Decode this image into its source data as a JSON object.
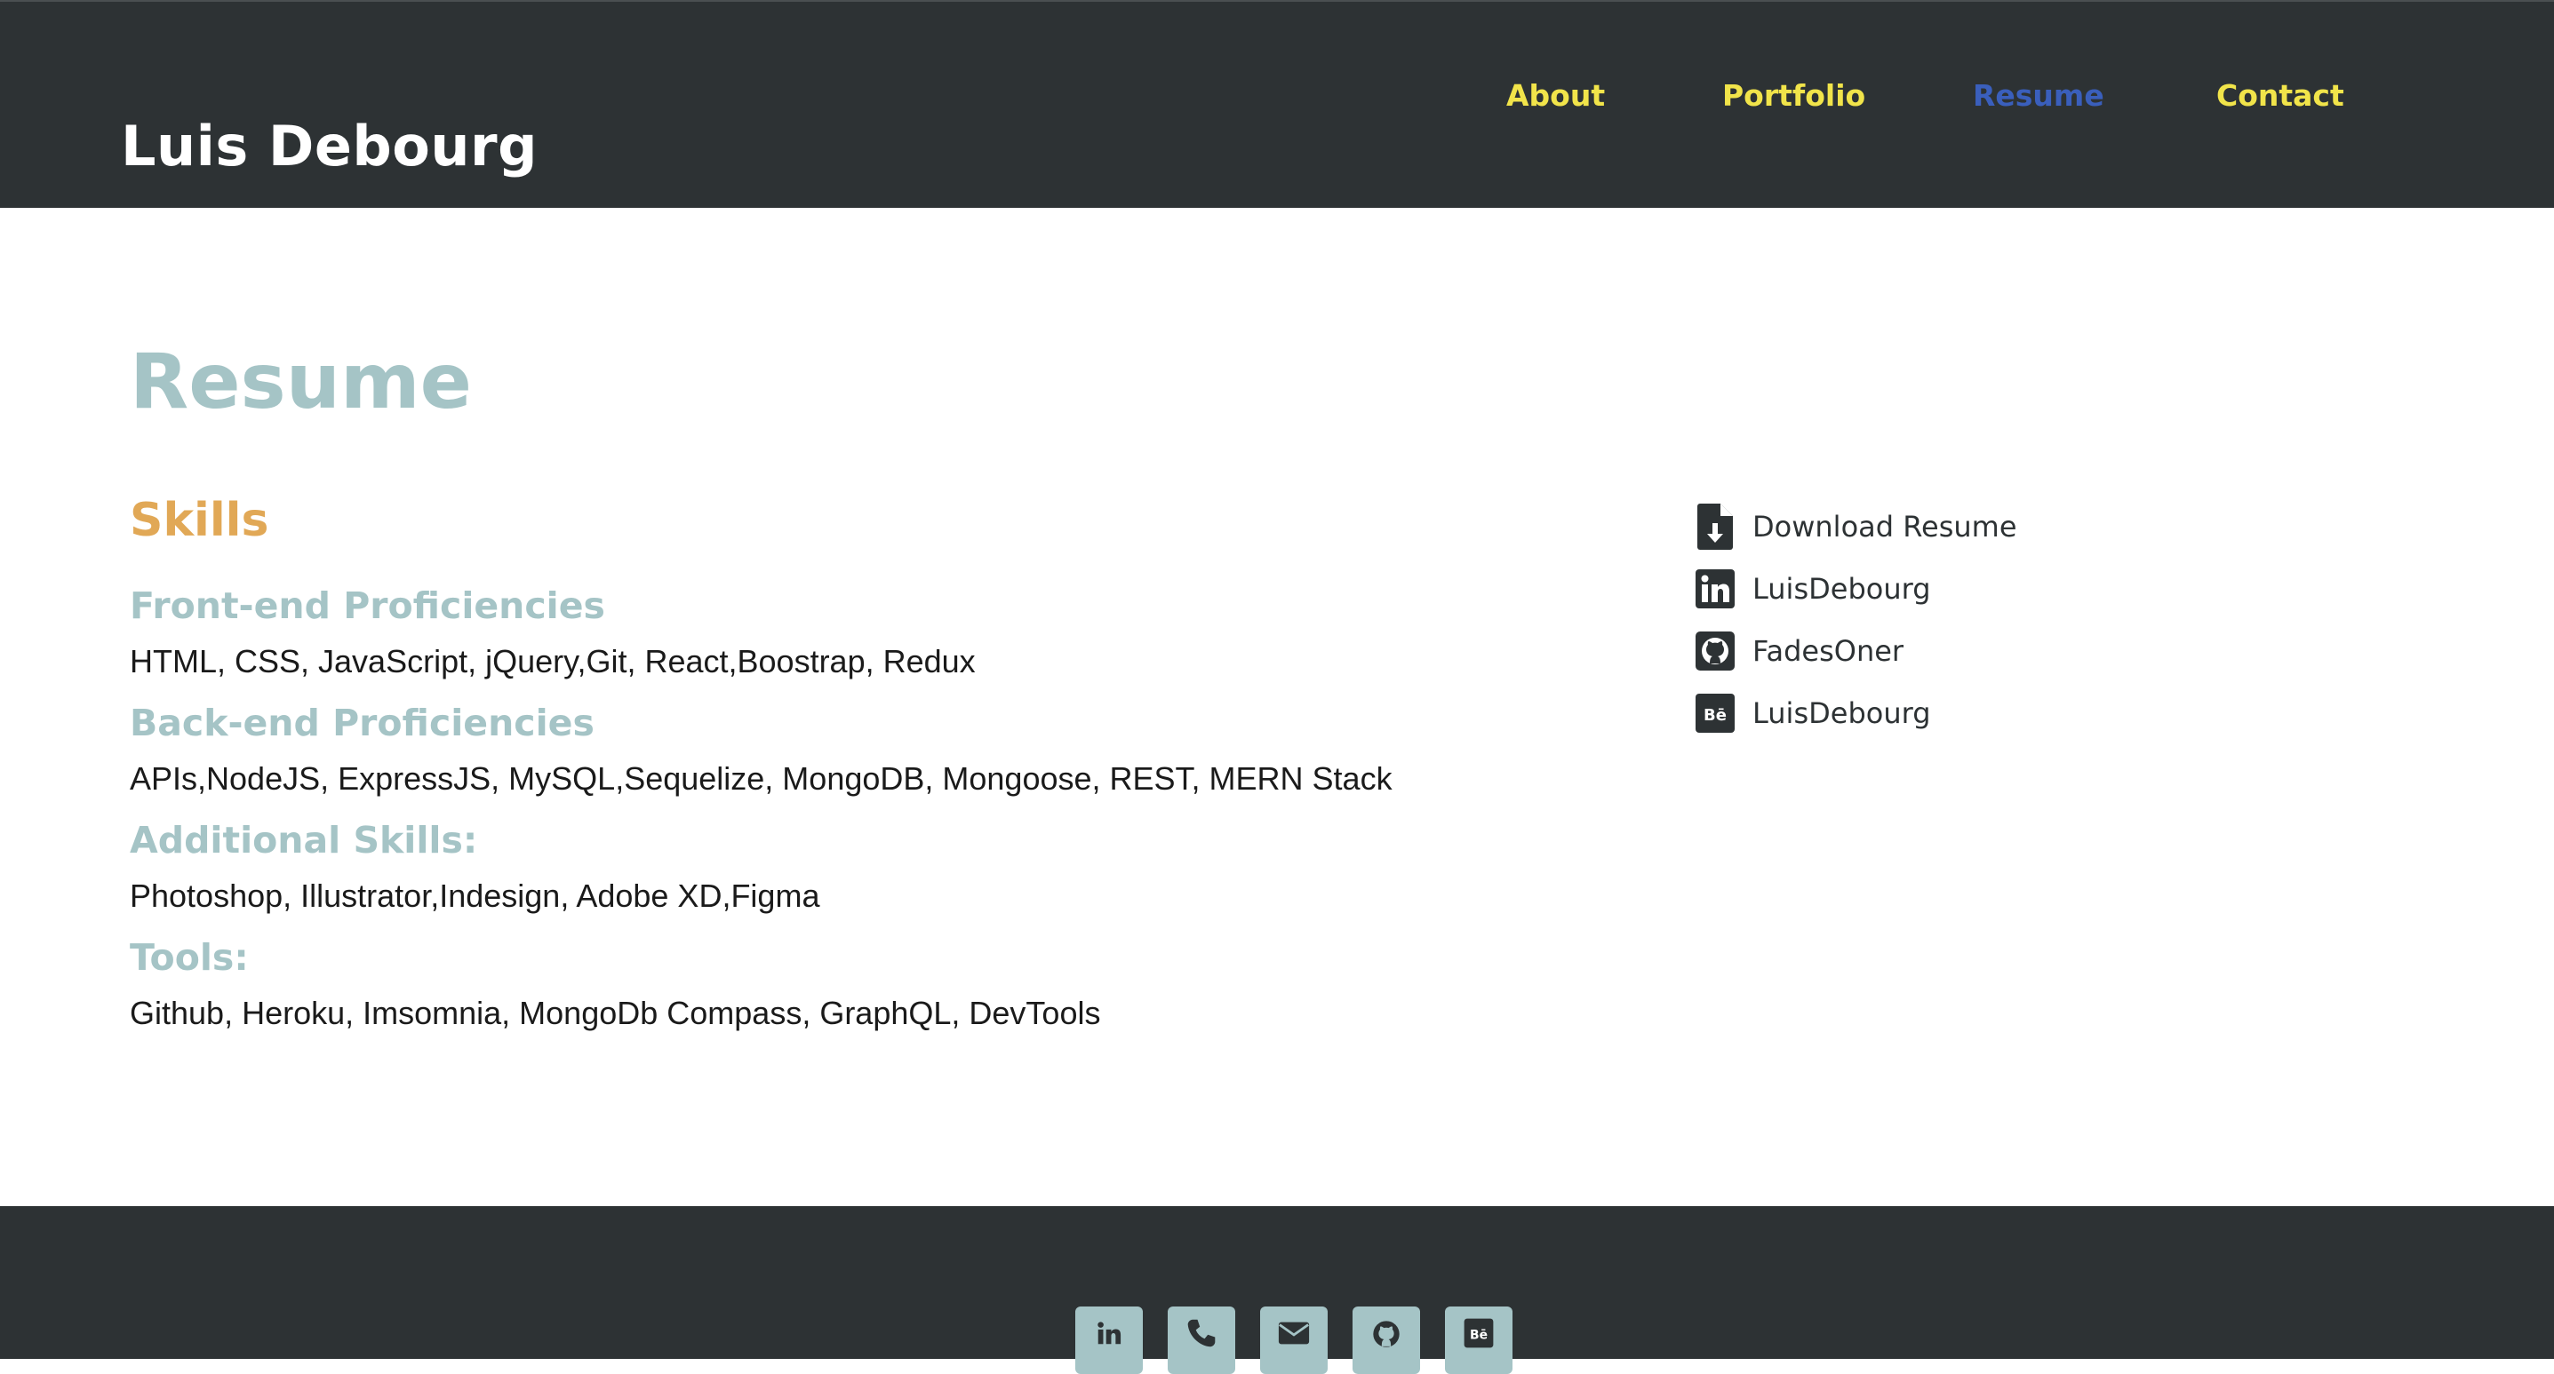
{
  "header": {
    "brand": "Luis Debourg",
    "nav": [
      {
        "label": "About",
        "active": false
      },
      {
        "label": "Portfolio",
        "active": false
      },
      {
        "label": "Resume",
        "active": true
      },
      {
        "label": "Contact",
        "active": false
      }
    ]
  },
  "main": {
    "title": "Resume",
    "section_title": "Skills",
    "skills": [
      {
        "heading": "Front-end Proficiencies",
        "text": "HTML, CSS, JavaScript, jQuery,Git, React,Boostrap, Redux"
      },
      {
        "heading": "Back-end Proficiencies",
        "text": "APIs,NodeJS, ExpressJS, MySQL,Sequelize, MongoDB, Mongoose, REST, MERN Stack"
      },
      {
        "heading": "Additional Skills:",
        "text": "Photoshop, Illustrator,Indesign, Adobe XD,Figma"
      },
      {
        "heading": "Tools:",
        "text": "Github, Heroku, Imsomnia, MongoDb Compass, GraphQL, DevTools"
      }
    ]
  },
  "links": [
    {
      "icon": "file-download-icon",
      "label": "Download Resume"
    },
    {
      "icon": "linkedin-icon",
      "label": "LuisDebourg"
    },
    {
      "icon": "github-icon",
      "label": "FadesOner"
    },
    {
      "icon": "behance-icon",
      "label": "LuisDebourg"
    }
  ],
  "footer": {
    "social_icons": [
      "linkedin-icon",
      "phone-icon",
      "envelope-icon",
      "github-icon",
      "behance-icon"
    ],
    "behance_text": "Bē"
  },
  "colors": {
    "header_bg": "#2d3234",
    "nav_link": "#f1e44a",
    "nav_active": "#3a5fbc",
    "title": "#a5c4c6",
    "section_title": "#e1a856",
    "social_bg": "#a5c4c6"
  }
}
